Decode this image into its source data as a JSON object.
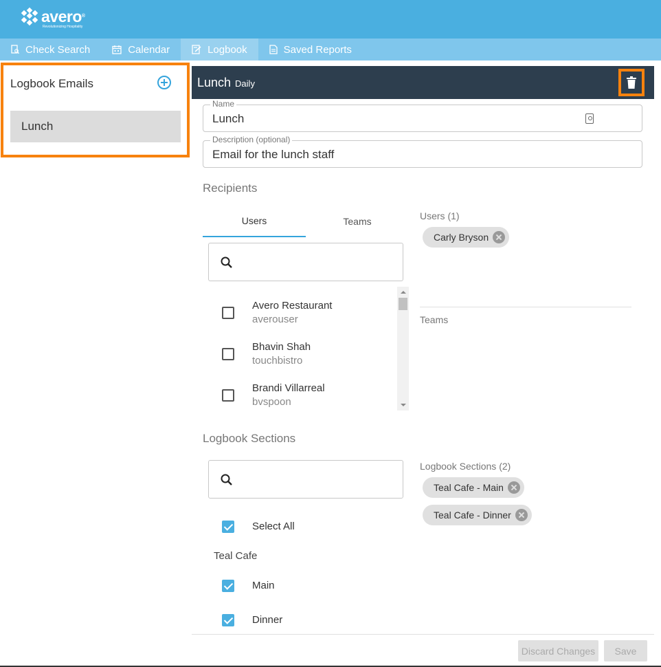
{
  "brand": {
    "name": "avero",
    "trademark": "®",
    "tagline": "Revolutionizing Hospitality",
    "primary_color": "#4aafe0",
    "accent_color": "#f7820e"
  },
  "nav": {
    "items": [
      {
        "label": "Check Search",
        "icon": "check-search-icon"
      },
      {
        "label": "Calendar",
        "icon": "calendar-icon"
      },
      {
        "label": "Logbook",
        "icon": "logbook-icon",
        "active": true
      },
      {
        "label": "Saved Reports",
        "icon": "document-icon"
      }
    ]
  },
  "sidebar": {
    "title": "Logbook Emails",
    "items": [
      {
        "label": "Lunch"
      }
    ]
  },
  "header": {
    "title": "Lunch",
    "frequency": "Daily"
  },
  "form": {
    "name": {
      "label": "Name",
      "value": "Lunch"
    },
    "description": {
      "label": "Description (optional)",
      "value": "Email for the lunch staff"
    }
  },
  "recipients": {
    "title": "Recipients",
    "tabs": [
      {
        "label": "Users"
      },
      {
        "label": "Teams"
      }
    ],
    "users": [
      {
        "name": "Avero Restaurant",
        "username": "averouser"
      },
      {
        "name": "Bhavin Shah",
        "username": "touchbistro"
      },
      {
        "name": "Brandi Villarreal",
        "username": "bvspoon"
      }
    ],
    "selected_users_label": "Users (1)",
    "selected_users": [
      "Carly Bryson"
    ],
    "teams_label": "Teams"
  },
  "sections": {
    "title": "Logbook Sections",
    "select_all": "Select All",
    "group": "Teal Cafe",
    "items": [
      {
        "label": "Main"
      },
      {
        "label": "Dinner"
      }
    ],
    "selected_label": "Logbook Sections (2)",
    "selected": [
      "Teal Cafe - Main",
      "Teal Cafe - Dinner"
    ]
  },
  "footer": {
    "discard_label": "Discard Changes",
    "save_label": "Save"
  }
}
